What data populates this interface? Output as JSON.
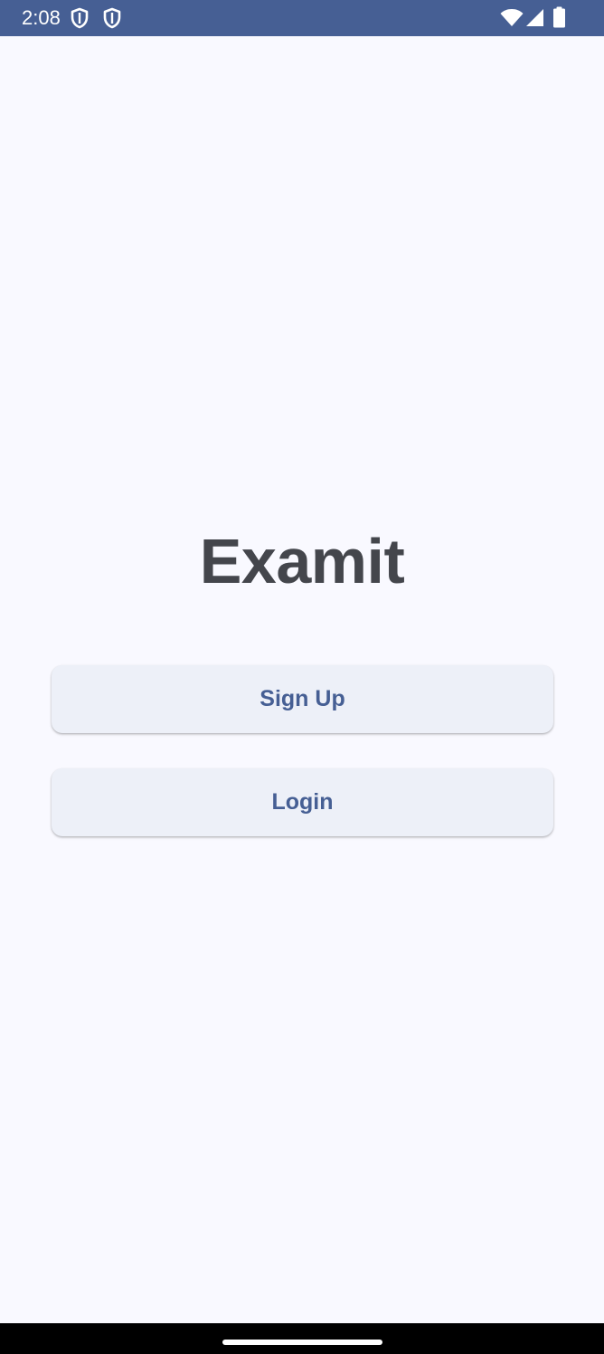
{
  "status_bar": {
    "time": "2:08",
    "left_icons": [
      "shield-icon",
      "shield-icon"
    ],
    "right_icons": [
      "wifi-icon",
      "signal-icon",
      "battery-icon"
    ],
    "background": "#465f94"
  },
  "app": {
    "title": "Examit"
  },
  "buttons": {
    "signup_label": "Sign Up",
    "login_label": "Login"
  },
  "colors": {
    "primary": "#465f94",
    "background": "#f9f9ff",
    "button_surface": "#edf0f8",
    "title_text": "#44464c"
  }
}
